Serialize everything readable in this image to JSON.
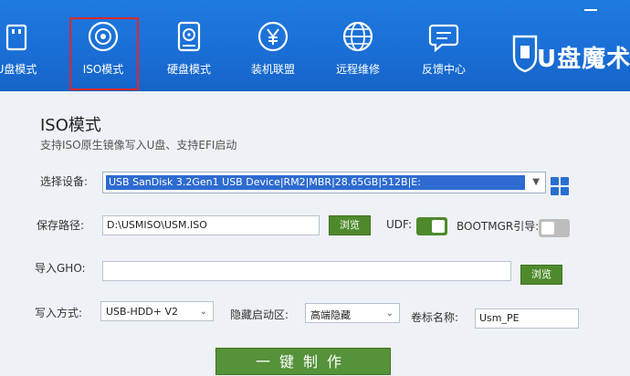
{
  "nav": {
    "items": [
      {
        "label": "U盘模式",
        "icon": "usb-drive-icon"
      },
      {
        "label": "ISO模式",
        "icon": "disc-icon"
      },
      {
        "label": "硬盘模式",
        "icon": "hard-disk-icon"
      },
      {
        "label": "装机联盟",
        "icon": "yen-coin-icon"
      },
      {
        "label": "远程维修",
        "icon": "globe-icon"
      },
      {
        "label": "反馈中心",
        "icon": "chat-bubble-icon"
      }
    ],
    "logo_text": "U盘魔术"
  },
  "page": {
    "title": "ISO模式",
    "subtitle": "支持ISO原生镜像写入U盘、支持EFI启动"
  },
  "form": {
    "device_label": "选择设备:",
    "device_value": "USB  SanDisk 3.2Gen1 USB Device|RM2|MBR|28.65GB|512B|E:",
    "save_path_label": "保存路径:",
    "save_path_value": "D:\\USMISO\\USM.ISO",
    "browse_label": "浏览",
    "udf_label": "UDF:",
    "udf_on": true,
    "bootmgr_label": "BOOTMGR引导:",
    "bootmgr_on": false,
    "gho_label": "导入GHO:",
    "gho_value": "",
    "browse2_label": "浏览",
    "write_mode_label": "写入方式:",
    "write_mode_value": "USB-HDD+ V2",
    "hidden_partition_label": "隐藏启动区:",
    "hidden_partition_value": "高端隐藏",
    "volume_name_label": "卷标名称:",
    "volume_name_value": "Usm_PE",
    "action_label": "一键制作"
  },
  "colors": {
    "header_blue": "#1a6fd6",
    "accent_green": "#4e8a2c",
    "highlight_red": "#e5252a"
  }
}
